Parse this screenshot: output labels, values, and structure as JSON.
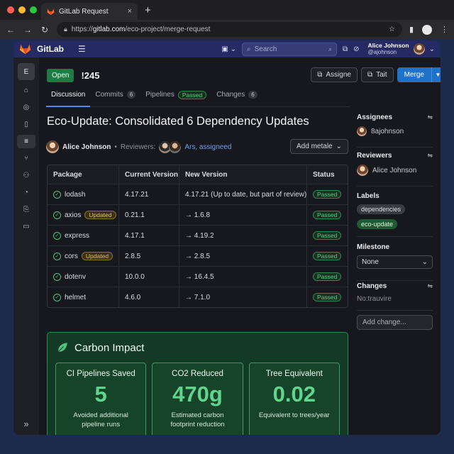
{
  "browser": {
    "tab_title": "GitLab Request",
    "tab_close": "×",
    "new_tab": "+",
    "url_prefix": "https://",
    "url_host": "gitlab.com",
    "url_path": "/eco-project/merge-request",
    "dot_colors": [
      "#ff5f57",
      "#febc2e",
      "#28c840"
    ]
  },
  "topnav": {
    "brand": "GitLab",
    "search_placeholder": "Search",
    "user_name": "Alice Johnson",
    "user_handle": "@ajohnson"
  },
  "sidebar": {
    "project_letter": "E",
    "items": [
      "home-icon",
      "issues-icon",
      "document-icon",
      "merge-request-list-icon",
      "branch-icon",
      "group-icon",
      "pipeline-icon",
      "deploy-icon",
      "folder-icon"
    ],
    "collapse": "»"
  },
  "mr": {
    "status": "Open",
    "id": "!245",
    "assign_label": "Assigne",
    "edit_label": "Tait",
    "merge_label": "Merge",
    "title": "Eco-Update: Consolidated 6 Dependency Updates",
    "author": "Alice Johnson",
    "reviewers_label": "Reviewers:",
    "reviewers_link": "Ars, assigneed",
    "metadata_button": "Add metale"
  },
  "tabs": [
    {
      "label": "Discussion",
      "badge": ""
    },
    {
      "label": "Commits",
      "badge": "6"
    },
    {
      "label": "Pipelines",
      "badge": "Passed"
    },
    {
      "label": "Changes",
      "badge": "6"
    }
  ],
  "table": {
    "headers": [
      "Package",
      "Current Version",
      "New Version",
      "Status"
    ],
    "rows": [
      {
        "package": "lodash",
        "tag": "",
        "current": "4.17.21",
        "new": "4.17.21 (Up to date, but part of review)",
        "status": "Passed"
      },
      {
        "package": "axios",
        "tag": "Updated",
        "current": "0.21.1",
        "new": "→ 1.6.8",
        "status": "Passed"
      },
      {
        "package": "express",
        "tag": "",
        "current": "4.17.1",
        "new": "→ 4.19.2",
        "status": "Passed"
      },
      {
        "package": "cors",
        "tag": "Updated",
        "current": "2.8.5",
        "new": "→ 2.8.5",
        "status": "Passed"
      },
      {
        "package": "dotenv",
        "tag": "",
        "current": "10.0.0",
        "new": "→ 16.4.5",
        "status": "Passed"
      },
      {
        "package": "helmet",
        "tag": "",
        "current": "4.6.0",
        "new": "→ 7.1.0",
        "status": "Passed"
      }
    ]
  },
  "carbon": {
    "title": "Carbon Impact",
    "cards": [
      {
        "label": "CI Pipelines Saved",
        "value": "5",
        "sub": "Avoided additional pipeline runs"
      },
      {
        "label": "CO2 Reduced",
        "value": "470g",
        "sub": "Estimated carbon footprint reduction"
      },
      {
        "label": "Tree Equivalent",
        "value": "0.02",
        "sub": "Equivalent to trees/year"
      }
    ]
  },
  "right_sidebar": {
    "assignees_title": "Assignees",
    "assignee": "8ajohnson",
    "reviewers_title": "Reviewers",
    "reviewer": "Alice Johnson",
    "labels_title": "Labels",
    "labels": [
      "dependencies",
      "eco-update"
    ],
    "milestone_title": "Milestone",
    "milestone_value": "None",
    "changes_title": "Changes",
    "changes_value": "No:trauvire",
    "add_change_placeholder": "Add change..."
  },
  "colors": {
    "brand_nav": "#252a63",
    "accent_blue": "#1f72c9",
    "success_green": "#4fc47c",
    "carbon_bg": "#123a24"
  }
}
